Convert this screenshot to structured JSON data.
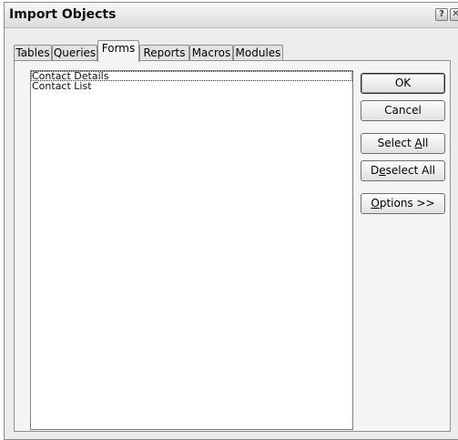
{
  "dialog": {
    "title": "Import Objects",
    "help_glyph": "?",
    "close_glyph": "✕"
  },
  "tabs": [
    {
      "label": "Tables",
      "active": false
    },
    {
      "label": "Queries",
      "active": false
    },
    {
      "label": "Forms",
      "active": true
    },
    {
      "label": "Reports",
      "active": false
    },
    {
      "label": "Macros",
      "active": false
    },
    {
      "label": "Modules",
      "active": false
    }
  ],
  "objects_list": {
    "items": [
      {
        "label": "Contact Details",
        "selected": true
      },
      {
        "label": "Contact List",
        "selected": false
      }
    ]
  },
  "buttons": {
    "ok": "OK",
    "cancel": "Cancel",
    "select_all_prefix": "Select ",
    "select_all_mnemonic": "A",
    "select_all_suffix": "ll",
    "deselect_all_prefix": "D",
    "deselect_all_mnemonic": "e",
    "deselect_all_suffix": "select All",
    "options_mnemonic": "O",
    "options_suffix": "ptions >>"
  }
}
